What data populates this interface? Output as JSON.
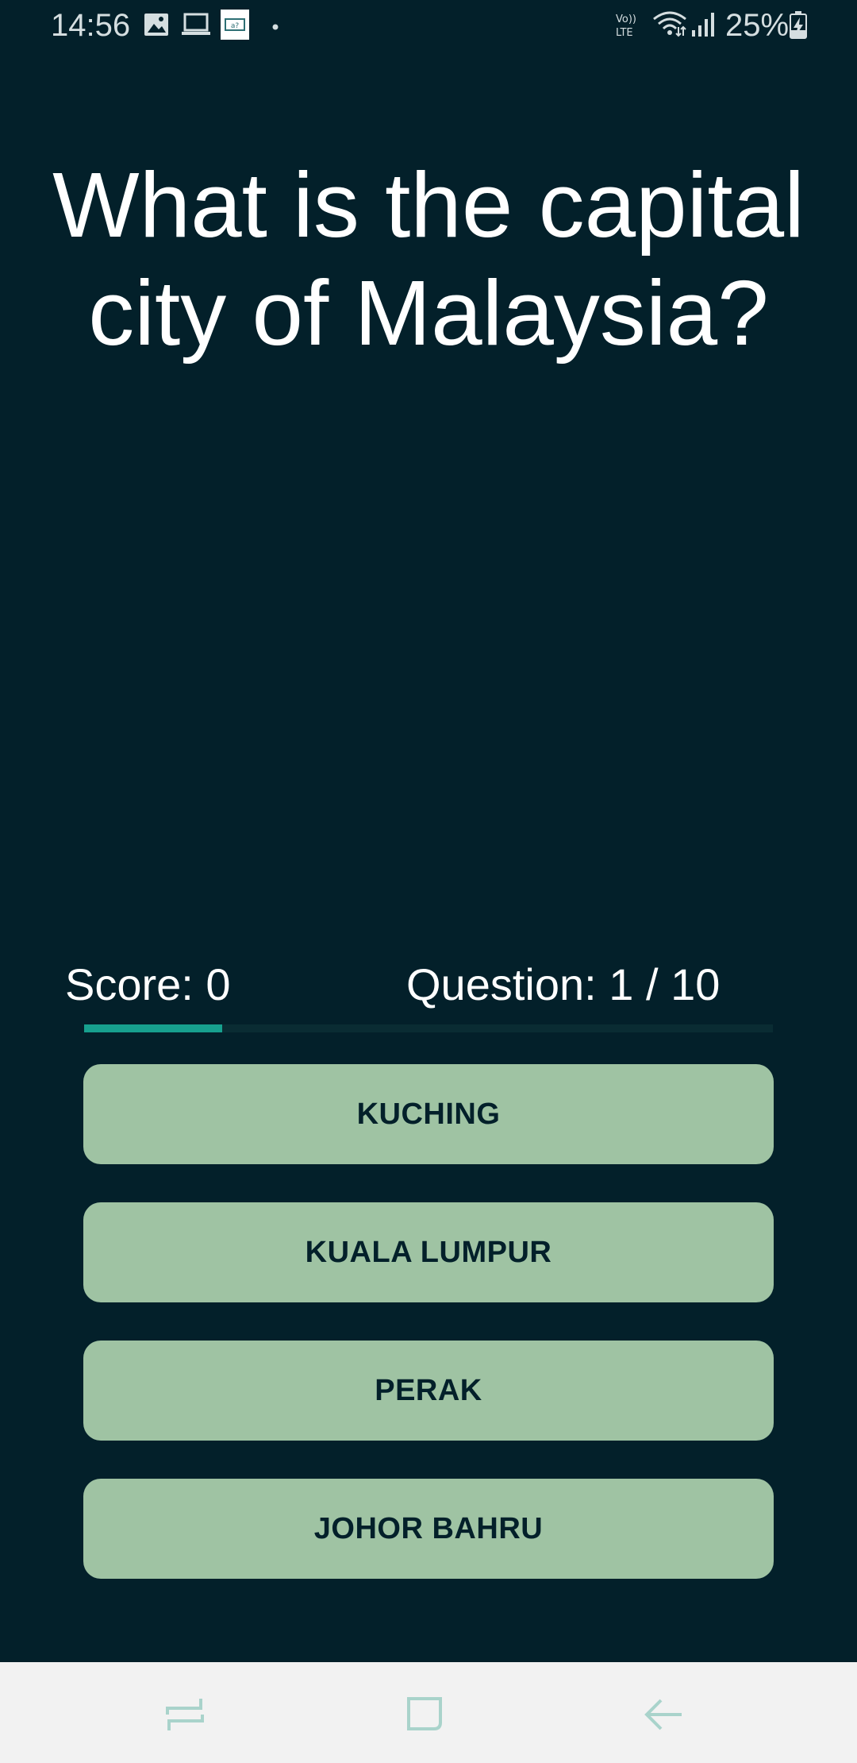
{
  "status_bar": {
    "time": "14:56",
    "battery_percent": "25%",
    "left_icons": [
      "gallery-icon",
      "laptop-icon",
      "notification-app-icon",
      "dot-icon"
    ],
    "right_icons": [
      "volte-icon",
      "wifi-icon",
      "signal-icon",
      "battery-charging-icon"
    ]
  },
  "quiz": {
    "question": "What is the capital city of Malaysia?",
    "score_text": "Score: 0",
    "question_counter_text": "Question: 1 / 10",
    "progress_fraction": 0.2,
    "answers": [
      "KUCHING",
      "KUALA LUMPUR",
      "PERAK",
      "JOHOR BAHRU"
    ]
  },
  "colors": {
    "background": "#03202A",
    "answer_button": "#9FC3A3",
    "progress": "#17A08E"
  },
  "nav_bar": {
    "icons": [
      "recent-apps-icon",
      "home-icon",
      "back-icon"
    ]
  }
}
